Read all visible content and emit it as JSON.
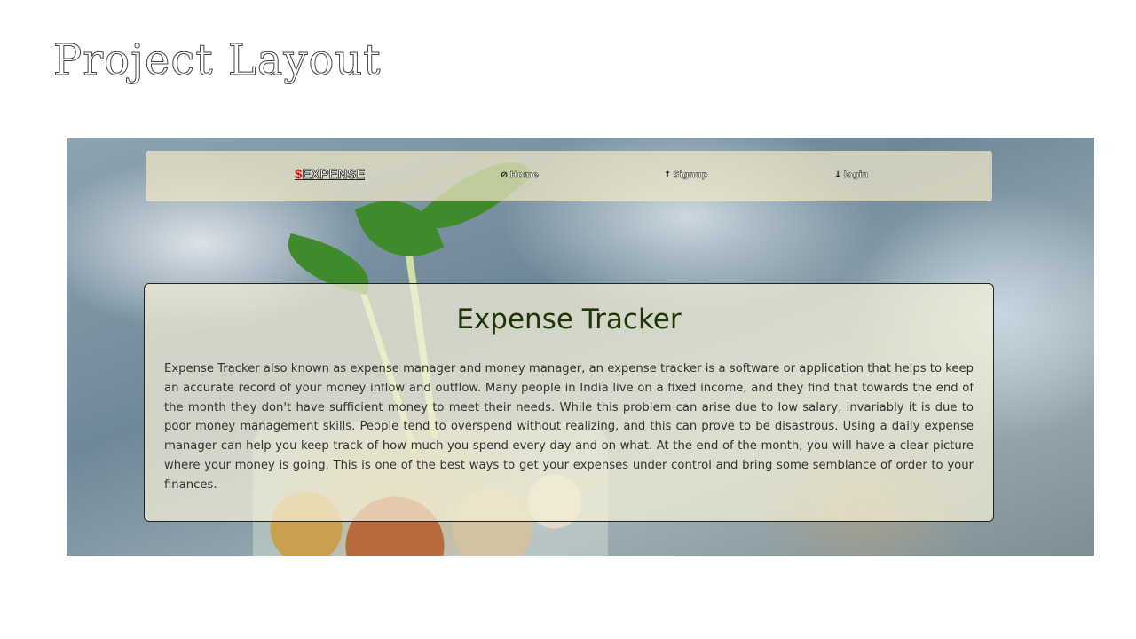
{
  "slide": {
    "title": "Project Layout"
  },
  "navbar": {
    "brand_symbol": "$",
    "brand_text": "EXPENSE",
    "links": [
      {
        "icon": "⊘",
        "icon_name": "home-icon",
        "label": "Home"
      },
      {
        "icon": "↑",
        "icon_name": "arrow-up-icon",
        "label": "Signup"
      },
      {
        "icon": "↓",
        "icon_name": "arrow-down-icon",
        "label": "login"
      }
    ]
  },
  "card": {
    "title": "Expense Tracker",
    "body": "Expense Tracker also known as expense manager and money manager, an expense tracker is a software or application that helps to keep an accurate record of your money inflow and outflow. Many people in India live on a fixed income, and they find that towards the end of the month they don't have sufficient money to meet their needs. While this problem can arise due to low salary, invariably it is due to poor money management skills. People tend to overspend without realizing, and this can prove to be disastrous. Using a daily expense manager can help you keep track of how much you spend every day and on what. At the end of the month, you will have a clear picture where your money is going. This is one of the best ways to get your expenses under control and bring some semblance of order to your finances."
  },
  "colors": {
    "brand_dollar": "#d01010",
    "card_title": "#1e3508",
    "navbar_bg": "#f0e8c8",
    "card_bg": "#f5f0d7"
  }
}
